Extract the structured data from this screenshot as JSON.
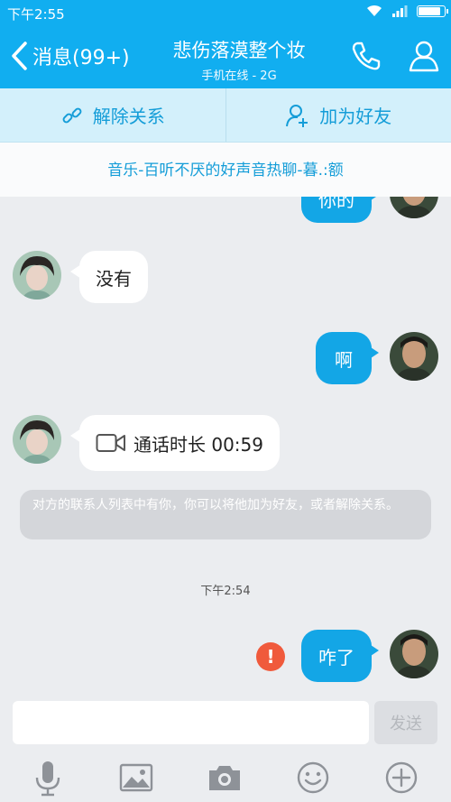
{
  "status": {
    "time": "下午2:55",
    "battery_level": 0.92
  },
  "header": {
    "back_label": "消息(99+)",
    "contact_name": "悲伤落漠整个妆",
    "subtitle": "手机在线 - 2G",
    "icons": [
      "phone-icon",
      "profile-icon"
    ]
  },
  "actions": {
    "unlink_label": "解除关系",
    "add_friend_label": "加为好友"
  },
  "banner": {
    "text": "音乐-百听不厌的好声音热聊-暮.:额"
  },
  "messages": [
    {
      "side": "out",
      "text": "你的"
    },
    {
      "side": "in",
      "text": "没有"
    },
    {
      "side": "out",
      "text": "啊"
    },
    {
      "side": "in",
      "type": "video-call",
      "text": "通话时长 00:59"
    },
    {
      "type": "system",
      "text": "对方的联系人列表中有你，你可以将他加为好友，或者解除关系。"
    },
    {
      "type": "timestamp",
      "text": "下午2:54"
    },
    {
      "side": "out",
      "text": "咋了",
      "status": "failed"
    }
  ],
  "input": {
    "value": "",
    "send_label": "发送"
  },
  "toolbar": {
    "icons": [
      "microphone-icon",
      "image-icon",
      "camera-icon",
      "emoji-icon",
      "plus-icon"
    ]
  },
  "colors": {
    "accent": "#11aef0",
    "outgoing_bubble": "#13a6e6",
    "error": "#f05a3c"
  }
}
